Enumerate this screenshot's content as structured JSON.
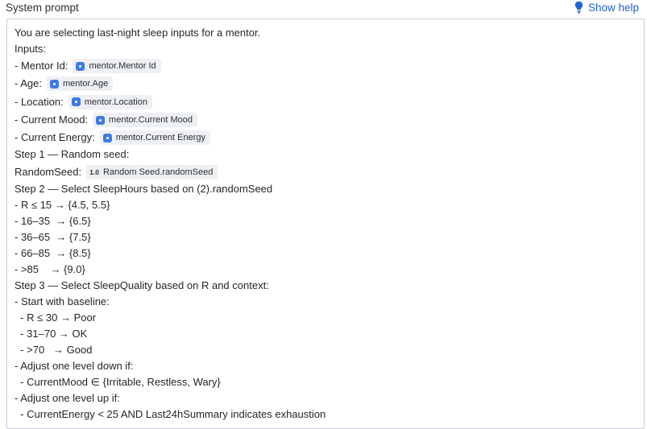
{
  "header": {
    "title": "System prompt",
    "help_label": "Show help",
    "help_icon": "lightbulb-icon"
  },
  "colors": {
    "accent": "#1f63d8",
    "chip_bg": "#eef0f3",
    "chip_icon": "#3f7be6",
    "border": "#c9ced6"
  },
  "prompt": {
    "intro": "You are selecting last-night sleep inputs for a mentor.",
    "inputs_heading": "Inputs:",
    "inputs": [
      {
        "label": "- Mentor Id:",
        "chip": "mentor.Mentor Id"
      },
      {
        "label": "- Age:",
        "chip": "mentor.Age"
      },
      {
        "label": "- Location:",
        "chip": "mentor.Location"
      },
      {
        "label": "- Current Mood:",
        "chip": "mentor.Current Mood"
      },
      {
        "label": "- Current Energy:",
        "chip": "mentor.Current Energy"
      }
    ],
    "step1": "Step 1 — Random seed:",
    "seed_label": "RandomSeed:",
    "seed_chip_prefix": "1.0",
    "seed_chip": "Random Seed.randomSeed",
    "step2": "Step 2 — Select SleepHours based on (2).randomSeed",
    "step2_rules": [
      "- R ≤ 15 → {4.5, 5.5}",
      "- 16–35  → {6.5}",
      "- 36–65  → {7.5}",
      "- 66–85  → {8.5}",
      "- >85    → {9.0}"
    ],
    "step3": "Step 3 — Select SleepQuality based on R and context:",
    "baseline_heading": "- Start with baseline:",
    "baseline_rules": [
      "  - R ≤ 30 → Poor",
      "  - 31–70 → OK",
      "  - >70   → Good"
    ],
    "down_heading": "- Adjust one level down if:",
    "down_rule": "  - CurrentMood ∈ {Irritable, Restless, Wary}",
    "up_heading": "- Adjust one level up if:",
    "up_rule": "  - CurrentEnergy < 25 AND Last24hSummary indicates exhaustion"
  }
}
